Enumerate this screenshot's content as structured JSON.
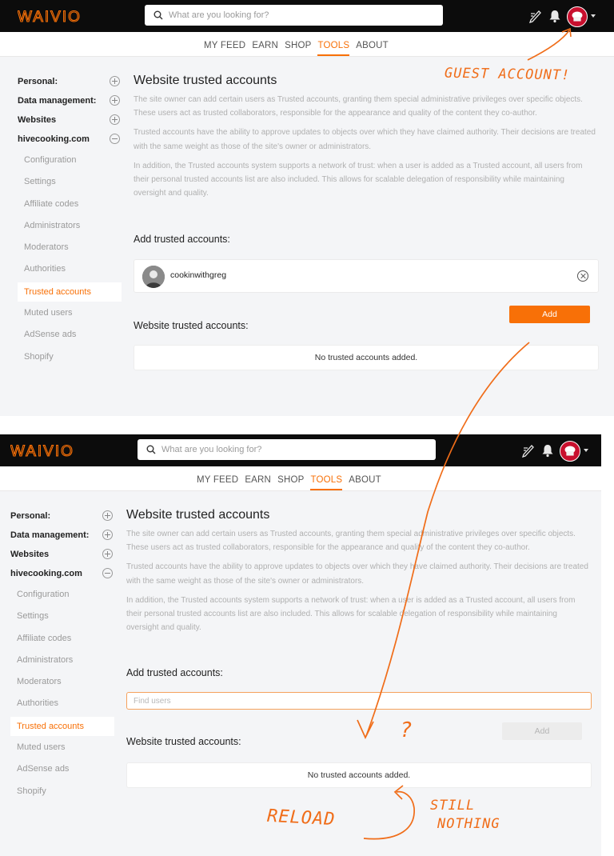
{
  "app": {
    "logo_text": "WAIVIO",
    "search_placeholder": "What are you looking for?",
    "nav": [
      {
        "label": "MY FEED"
      },
      {
        "label": "EARN"
      },
      {
        "label": "SHOP"
      },
      {
        "label": "TOOLS",
        "active": true
      },
      {
        "label": "ABOUT"
      }
    ],
    "accent_color": "#f87007"
  },
  "sidebar": {
    "sections": [
      {
        "label": "Personal:",
        "expanded": false
      },
      {
        "label": "Data management:",
        "expanded": false
      },
      {
        "label": "Websites",
        "expanded": false
      },
      {
        "label": "hivecooking.com",
        "expanded": true
      }
    ],
    "items": [
      {
        "label": "Configuration"
      },
      {
        "label": "Settings"
      },
      {
        "label": "Affiliate codes"
      },
      {
        "label": "Administrators"
      },
      {
        "label": "Moderators"
      },
      {
        "label": "Authorities"
      },
      {
        "label": "Trusted accounts",
        "active": true
      },
      {
        "label": "Muted users"
      },
      {
        "label": "AdSense ads"
      },
      {
        "label": "Shopify"
      }
    ]
  },
  "page": {
    "title": "Website trusted accounts",
    "paragraphs": [
      "The site owner can add certain users as Trusted accounts, granting them special administrative privileges over specific objects. These users act as trusted collaborators, responsible for the appearance and quality of the content they co-author.",
      "Trusted accounts have the ability to approve updates to objects over which they have claimed authority. Their decisions are treated with the same weight as those of the site's owner or administrators.",
      "In addition, the Trusted accounts system supports a network of trust: when a user is added as a Trusted account, all users from their personal trusted accounts list are also included. This allows for scalable delegation of responsibility while maintaining oversight and quality."
    ],
    "add_label": "Add trusted accounts:",
    "add_button": "Add",
    "list_label": "Website trusted accounts:",
    "empty_text": "No trusted accounts added."
  },
  "screen1": {
    "selected_user": "cookinwithgreg",
    "add_button_enabled": true
  },
  "screen2": {
    "find_placeholder": "Find users",
    "add_button_enabled": false
  },
  "annotations": {
    "guest": "GUEST ACCOUNT!",
    "question": "?",
    "reload": "RELOAD",
    "still": "STILL",
    "nothing": "NOTHING"
  }
}
